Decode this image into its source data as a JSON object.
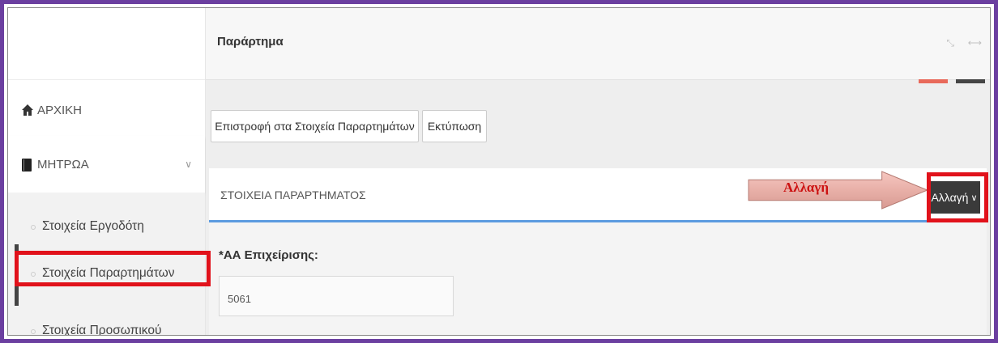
{
  "sidebar": {
    "home": "ΑΡΧΙΚΗ",
    "registry": "ΜΗΤΡΩΑ",
    "submenu": [
      "Στοιχεία Εργοδότη",
      "Στοιχεία Παραρτημάτων",
      "Στοιχεία Προσωπικού"
    ]
  },
  "header": {
    "title": "Παράρτημα"
  },
  "toolbar": {
    "back_label": "Επιστροφή στα Στοιχεία Παραρτημάτων",
    "print_label": "Εκτύπωση"
  },
  "panel": {
    "title": "ΣΤΟΙΧΕΙΑ ΠΑΡΑΡΤΗΜΑΤΟΣ",
    "change_label": "Αλλαγή"
  },
  "form": {
    "label": "*ΑΑ Επιχείρισης:",
    "value": "5061"
  },
  "annotation": {
    "text": "Αλλαγή"
  },
  "colors": {
    "frame": "#6b3fa0",
    "highlight": "#e1121b",
    "accent": "#5c9be0"
  }
}
